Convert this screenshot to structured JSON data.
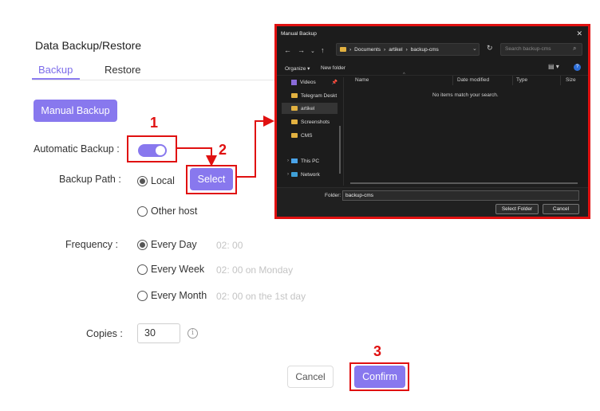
{
  "page": {
    "title": "Data Backup/Restore",
    "tabs": [
      {
        "label": "Backup",
        "active": true
      },
      {
        "label": "Restore",
        "active": false
      }
    ]
  },
  "backup": {
    "manual_button": "Manual Backup",
    "automatic_label": "Automatic Backup :",
    "automatic_enabled": true,
    "path_label": "Backup Path :",
    "path_options": [
      {
        "label": "Local",
        "selected": true
      },
      {
        "label": "Other host",
        "selected": false
      }
    ],
    "select_button": "Select",
    "frequency_label": "Frequency :",
    "frequency_options": [
      {
        "label": "Every Day",
        "time": "02: 00",
        "selected": true
      },
      {
        "label": "Every Week",
        "time": "02: 00 on Monday",
        "selected": false
      },
      {
        "label": "Every Month",
        "time": "02: 00 on the 1st day",
        "selected": false
      }
    ],
    "copies_label": "Copies :",
    "copies_value": "30",
    "cancel_button": "Cancel",
    "confirm_button": "Confirm"
  },
  "annotations": {
    "step1": "1",
    "step2": "2",
    "step3": "3",
    "color": "#e01010"
  },
  "dialog": {
    "title": "Manual Backup",
    "close": "✕",
    "path_segments": [
      "Documents",
      "artikel",
      "backup-cms"
    ],
    "search_placeholder": "Search backup-cms",
    "organize": "Organize ▾",
    "new_folder": "New folder",
    "sidebar": [
      {
        "label": "Videos",
        "icon": "video-icon",
        "pinned": true
      },
      {
        "label": "Telegram Deskt",
        "icon": "folder-icon"
      },
      {
        "label": "artikel",
        "icon": "folder-icon",
        "selected": true
      },
      {
        "label": "Screenshots",
        "icon": "folder-icon"
      },
      {
        "label": "CMS",
        "icon": "folder-icon"
      },
      {
        "label": "This PC",
        "icon": "pc-icon"
      },
      {
        "label": "Network",
        "icon": "network-icon"
      }
    ],
    "columns": [
      "Name",
      "Date modified",
      "Type",
      "Size"
    ],
    "empty_message": "No items match your search.",
    "folder_label": "Folder:",
    "folder_value": "backup-cms",
    "select_folder_button": "Select Folder",
    "cancel_button": "Cancel"
  },
  "colors": {
    "accent": "#8878ee",
    "annotation_red": "#e01010",
    "dialog_bg": "#1c1c1c"
  }
}
